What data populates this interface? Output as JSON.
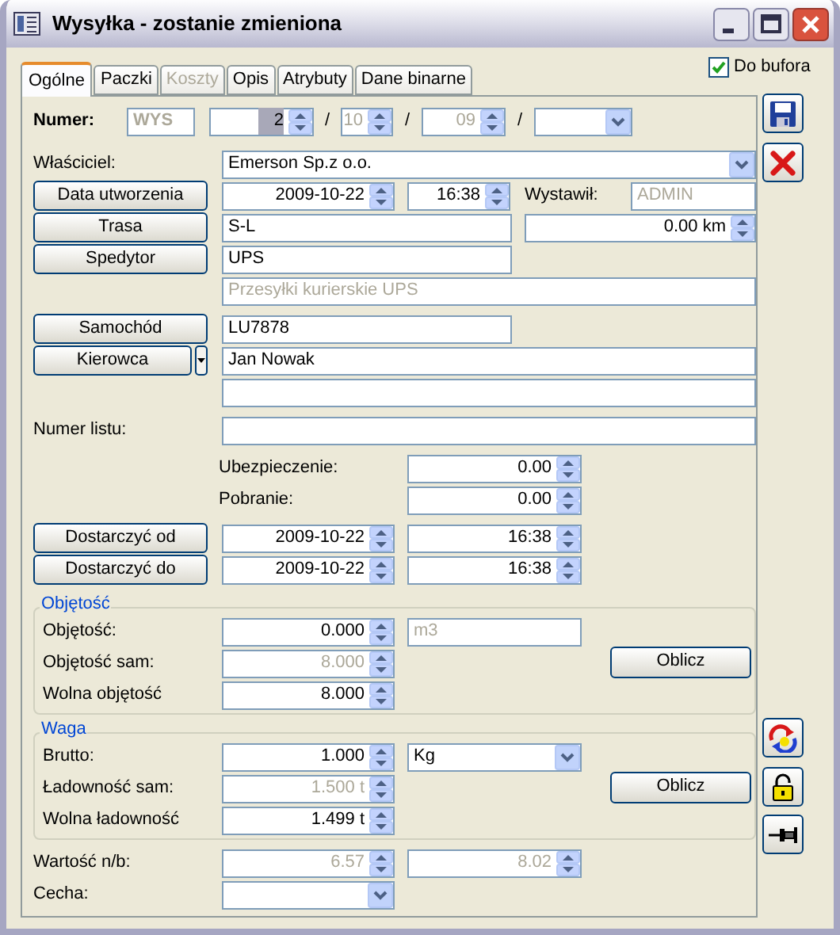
{
  "window": {
    "title": "Wysyłka - zostanie zmieniona"
  },
  "tabs": [
    {
      "label": "Ogólne",
      "selected": true,
      "disabled": false
    },
    {
      "label": "Paczki",
      "selected": false,
      "disabled": false
    },
    {
      "label": "Koszty",
      "selected": false,
      "disabled": true
    },
    {
      "label": "Opis",
      "selected": false,
      "disabled": false
    },
    {
      "label": "Atrybuty",
      "selected": false,
      "disabled": false
    },
    {
      "label": "Dane binarne",
      "selected": false,
      "disabled": false
    }
  ],
  "do_bufora": {
    "label": "Do bufora",
    "checked": true
  },
  "numer": {
    "label": "Numer:",
    "prefix": {
      "value": "WYS",
      "disabled": true
    },
    "number": {
      "value": "2",
      "text_selected": true
    },
    "month": {
      "value": "10",
      "disabled": true
    },
    "year": {
      "value": "09",
      "disabled": true
    },
    "separators": [
      "/",
      "/",
      "/"
    ]
  },
  "owner": {
    "label": "Właściciel:",
    "value": "Emerson Sp.z o.o."
  },
  "created": {
    "button": "Data utworzenia",
    "date": {
      "value": "2009-10-22"
    },
    "time": {
      "value": "16:38"
    }
  },
  "issuer": {
    "label": "Wystawił:",
    "field": {
      "value": "ADMIN",
      "disabled": true
    }
  },
  "route": {
    "button": "Trasa",
    "value": "S-L",
    "distance": "0.00 km"
  },
  "carrier": {
    "button": "Spedytor",
    "value": "UPS",
    "description": {
      "value": "Przesyłki kurierskie UPS",
      "disabled": true
    }
  },
  "vehicle": {
    "button": "Samochód",
    "value": "LU7878"
  },
  "driver": {
    "button": "Kierowca",
    "value": "Jan Nowak"
  },
  "waybill": {
    "label": "Numer listu:"
  },
  "insurance": {
    "label": "Ubezpieczenie:",
    "value": "0.00"
  },
  "cod": {
    "label": "Pobranie:",
    "value": "0.00"
  },
  "deliver_from": {
    "button": "Dostarczyć od",
    "date": "2009-10-22",
    "time": "16:38"
  },
  "deliver_to": {
    "button": "Dostarczyć do",
    "date": "2009-10-22",
    "time": "16:38"
  },
  "volume": {
    "title": "Objętość",
    "unit": {
      "value": "m3",
      "disabled": true
    },
    "button": "Oblicz",
    "rows": [
      {
        "label": "Objętość:",
        "value": "0.000",
        "disabled": false
      },
      {
        "label": "Objętość sam:",
        "value": "8.000",
        "disabled": true
      },
      {
        "label": "Wolna objętość",
        "value": "8.000",
        "disabled": false
      }
    ]
  },
  "weight": {
    "title": "Waga",
    "unit": "Kg",
    "button": "Oblicz",
    "rows": [
      {
        "label": "Brutto:",
        "value": "1.000",
        "disabled": false
      },
      {
        "label": "Ładowność sam:",
        "value": "1.500 t",
        "disabled": true
      },
      {
        "label": "Wolna ładowność",
        "value": "1.499 t",
        "disabled": false
      }
    ]
  },
  "value": {
    "label": "Wartość n/b:",
    "net": {
      "value": "6.57",
      "disabled": true
    },
    "gross": {
      "value": "8.02",
      "disabled": true
    }
  },
  "feature": {
    "label": "Cecha:"
  }
}
